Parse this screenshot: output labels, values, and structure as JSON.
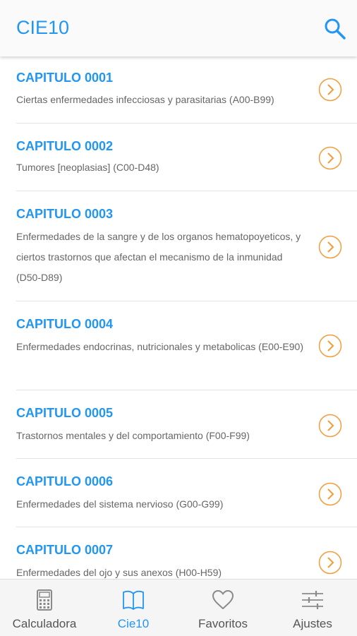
{
  "app": {
    "title": "CIE10",
    "accent_color": "#2196f3",
    "chevron_color": "#f39c3a"
  },
  "chapters": [
    {
      "title": "CAPITULO 0001",
      "description": "Ciertas enfermedades infecciosas y parasitarias (A00-B99)"
    },
    {
      "title": "CAPITULO 0002",
      "description": "Tumores [neoplasias] (C00-D48)"
    },
    {
      "title": "CAPITULO 0003",
      "description": "Enfermedades de la sangre y de los organos hematopoyeticos, y ciertos trastornos que afectan el mecanismo de la inmunidad (D50-D89)"
    },
    {
      "title": "CAPITULO 0004",
      "description": "Enfermedades endocrinas, nutricionales y metabolicas (E00-E90)"
    },
    {
      "title": "CAPITULO 0005",
      "description": "Trastornos mentales y del comportamiento (F00-F99)"
    },
    {
      "title": "CAPITULO 0006",
      "description": "Enfermedades del sistema nervioso (G00-G99)"
    },
    {
      "title": "CAPITULO 0007",
      "description": "Enfermedades del ojo y sus anexos (H00-H59)"
    }
  ],
  "tabs": [
    {
      "label": "Calculadora",
      "icon": "calculator-icon",
      "active": false
    },
    {
      "label": "Cie10",
      "icon": "book-icon",
      "active": true
    },
    {
      "label": "Favoritos",
      "icon": "heart-icon",
      "active": false
    },
    {
      "label": "Ajustes",
      "icon": "sliders-icon",
      "active": false
    }
  ]
}
